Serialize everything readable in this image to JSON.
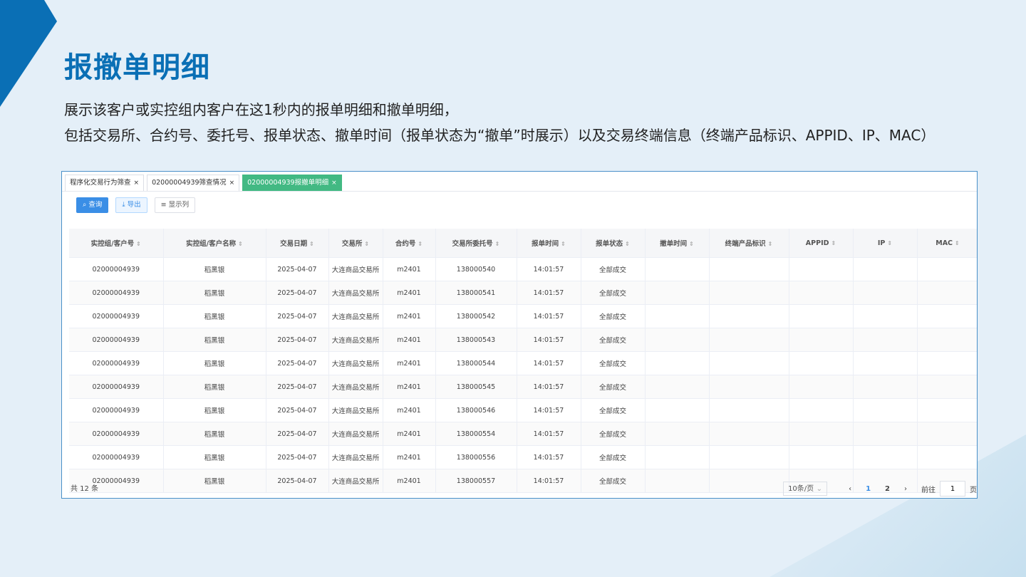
{
  "page": {
    "title": "报撤单明细",
    "desc_line1": "展示该客户或实控组内客户在这1秒内的报单明细和撤单明细，",
    "desc_line2": "包括交易所、合约号、委托号、报单状态、撤单时间（报单状态为“撤单”时展示）以及交易终端信息（终端产品标识、APPID、IP、MAC）"
  },
  "colors": {
    "brand": "#0a6fb5",
    "tab_active": "#42b983",
    "primary": "#3a8ee6"
  },
  "tabs": [
    {
      "label": "程序化交易行为筛查"
    },
    {
      "label": "02000004939筛查情况"
    },
    {
      "label": "02000004939报撤单明细"
    }
  ],
  "toolbar": {
    "query_label": "查询",
    "export_label": "导出",
    "columns_label": "显示列"
  },
  "table": {
    "headers": [
      "实控组/客户号",
      "实控组/客户名称",
      "交易日期",
      "交易所",
      "合约号",
      "交易所委托号",
      "报单时间",
      "报单状态",
      "撤单时间",
      "终端产品标识",
      "APPID",
      "IP",
      "MAC"
    ],
    "rows": [
      [
        "02000004939",
        "稻黑银",
        "2025-04-07",
        "大连商品交易所",
        "m2401",
        "138000540",
        "14:01:57",
        "全部成交",
        "",
        "",
        "",
        "",
        ""
      ],
      [
        "02000004939",
        "稻黑银",
        "2025-04-07",
        "大连商品交易所",
        "m2401",
        "138000541",
        "14:01:57",
        "全部成交",
        "",
        "",
        "",
        "",
        ""
      ],
      [
        "02000004939",
        "稻黑银",
        "2025-04-07",
        "大连商品交易所",
        "m2401",
        "138000542",
        "14:01:57",
        "全部成交",
        "",
        "",
        "",
        "",
        ""
      ],
      [
        "02000004939",
        "稻黑银",
        "2025-04-07",
        "大连商品交易所",
        "m2401",
        "138000543",
        "14:01:57",
        "全部成交",
        "",
        "",
        "",
        "",
        ""
      ],
      [
        "02000004939",
        "稻黑银",
        "2025-04-07",
        "大连商品交易所",
        "m2401",
        "138000544",
        "14:01:57",
        "全部成交",
        "",
        "",
        "",
        "",
        ""
      ],
      [
        "02000004939",
        "稻黑银",
        "2025-04-07",
        "大连商品交易所",
        "m2401",
        "138000545",
        "14:01:57",
        "全部成交",
        "",
        "",
        "",
        "",
        ""
      ],
      [
        "02000004939",
        "稻黑银",
        "2025-04-07",
        "大连商品交易所",
        "m2401",
        "138000546",
        "14:01:57",
        "全部成交",
        "",
        "",
        "",
        "",
        ""
      ],
      [
        "02000004939",
        "稻黑银",
        "2025-04-07",
        "大连商品交易所",
        "m2401",
        "138000554",
        "14:01:57",
        "全部成交",
        "",
        "",
        "",
        "",
        ""
      ],
      [
        "02000004939",
        "稻黑银",
        "2025-04-07",
        "大连商品交易所",
        "m2401",
        "138000556",
        "14:01:57",
        "全部成交",
        "",
        "",
        "",
        "",
        ""
      ],
      [
        "02000004939",
        "稻黑银",
        "2025-04-07",
        "大连商品交易所",
        "m2401",
        "138000557",
        "14:01:57",
        "全部成交",
        "",
        "",
        "",
        "",
        ""
      ]
    ]
  },
  "footer": {
    "total": "共 12 条",
    "page_size": "10条/页",
    "pages": [
      "1",
      "2"
    ],
    "current_page": "1",
    "goto_label": "前往",
    "goto_value": "1",
    "page_unit": "页"
  }
}
